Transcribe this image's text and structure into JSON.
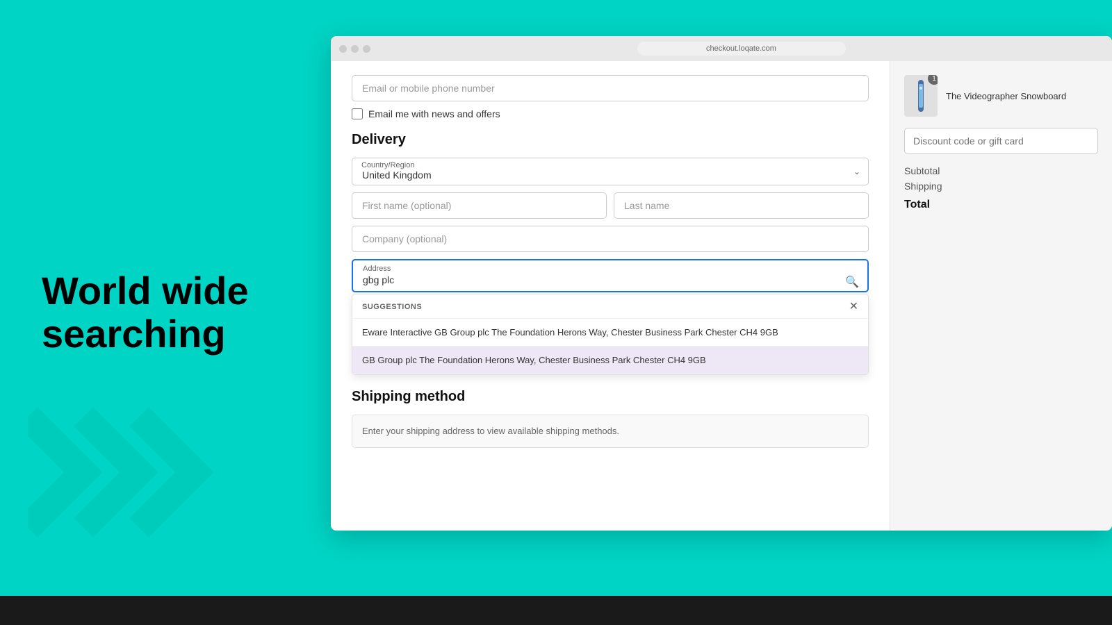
{
  "page": {
    "url": "checkout.loqate.com"
  },
  "hero": {
    "line1": "World wide",
    "line2": "searching"
  },
  "form": {
    "email_placeholder": "Email or mobile phone number",
    "email_label": "Email or mobile phone number",
    "checkbox_label": "Email me with news and offers",
    "delivery_title": "Delivery",
    "country_label": "Country/Region",
    "country_value": "United Kingdom",
    "first_name_placeholder": "First name (optional)",
    "last_name_placeholder": "Last name",
    "company_placeholder": "Company (optional)",
    "address_label": "Address",
    "address_value": "gbg plc",
    "suggestions_title": "SUGGESTIONS",
    "suggestion_1": "Eware Interactive GB Group plc The Foundation Herons Way, Chester Business Park Chester CH4 9GB",
    "suggestion_2": "GB Group plc The Foundation Herons Way, Chester Business Park Chester CH4 9GB",
    "shipping_title": "Shipping method",
    "shipping_placeholder": "Enter your shipping address to view available shipping methods."
  },
  "sidebar": {
    "product_name": "The Videographer Snowboard",
    "discount_placeholder": "Discount code or gift card",
    "subtotal_label": "Subtotal",
    "shipping_label": "Shipping",
    "total_label": "Total"
  },
  "icons": {
    "search": "🔍",
    "close": "✕",
    "chevron_down": "∨"
  }
}
